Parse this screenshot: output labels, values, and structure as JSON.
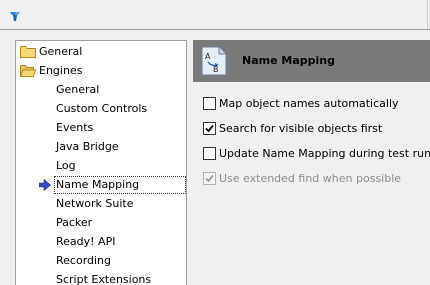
{
  "colors": {
    "header_bg": "#7a7a7a",
    "folder_yellow": "#f2c94c",
    "arrow_blue": "#3a4cc8"
  },
  "tree": {
    "groups": [
      {
        "label": "General",
        "icon": "folder-icon"
      },
      {
        "label": "Engines",
        "icon": "open-folder-icon"
      }
    ],
    "items": [
      {
        "label": "General"
      },
      {
        "label": "Custom Controls"
      },
      {
        "label": "Events"
      },
      {
        "label": "Java Bridge"
      },
      {
        "label": "Log"
      },
      {
        "label": "Name Mapping",
        "selected": true
      },
      {
        "label": "Network Suite"
      },
      {
        "label": "Packer"
      },
      {
        "label": "Ready! API"
      },
      {
        "label": "Recording"
      },
      {
        "label": "Script Extensions"
      }
    ]
  },
  "panel": {
    "title": "Name Mapping",
    "icon_letters": {
      "top": "A",
      "bottom": "B"
    },
    "options": [
      {
        "label": "Map object names automatically",
        "checked": false,
        "enabled": true
      },
      {
        "label": "Search for visible objects first",
        "checked": true,
        "enabled": true
      },
      {
        "label": "Update Name Mapping during test run",
        "checked": false,
        "enabled": true
      },
      {
        "label": "Use extended find when possible",
        "checked": true,
        "enabled": false
      }
    ]
  }
}
